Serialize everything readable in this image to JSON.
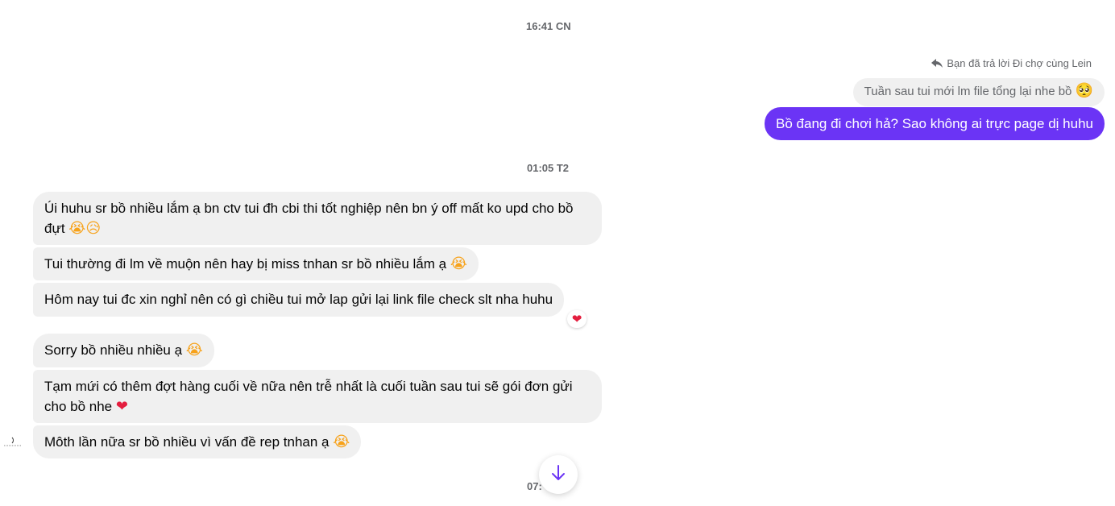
{
  "timestamps": {
    "t1": "16:41 CN",
    "t2": "01:05 T2",
    "t3": "07:"
  },
  "reply_note": "Bạn đã trả lời Đi chợ cùng Lein",
  "outgoing": {
    "quoted_text": "Tuần sau tui mới lm file tổng lại nhe bồ",
    "quoted_emoji": "🥺",
    "message": "Bồ đang đi chơi hả? Sao không ai trực page dị huhu"
  },
  "incoming": [
    {
      "text": "Úi huhu sr bồ nhiều lắm ạ bn ctv tui đh cbi thi tốt nghiệp nên bn ý off mất ko upd cho bồ đựt",
      "emoji": "😭😥"
    },
    {
      "text": "Tui thường đi lm về muộn nên hay bị miss tnhan sr bồ nhiều lắm ạ",
      "emoji": "😭"
    },
    {
      "text": "Hôm nay tui đc xin nghỉ nên có gì chiều tui mở lap gửi lại link file check slt nha huhu",
      "emoji": "",
      "reaction": "❤"
    },
    {
      "text": "Sorry bồ nhiều nhiều ạ",
      "emoji": "😭"
    },
    {
      "text": "Tạm mứi có thêm đợt hàng cuối về nữa nên trễ nhất là cuối tuần sau tui sẽ gói đơn gửi cho bồ nhe",
      "emoji": "❤"
    },
    {
      "text": "Môth lần nữa sr bồ nhiều vì vấn đề rep tnhan ạ",
      "emoji": "😭"
    }
  ],
  "colors": {
    "outgoing_bubble": "#6b34f5",
    "incoming_bubble": "#f0f0f0",
    "heart": "#e41e3f",
    "scroll_arrow": "#6b34f5"
  },
  "icons": {
    "reply": "reply-arrow-icon",
    "scroll": "arrow-down-icon"
  }
}
